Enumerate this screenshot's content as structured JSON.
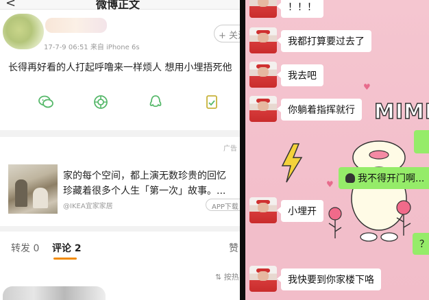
{
  "left": {
    "title": "微博正文",
    "back_glyph": "<",
    "post": {
      "meta": "17-7-9 06:51  来自 iPhone 6s",
      "follow_label": "+ 关注",
      "text": "长得再好看的人打起呼噜来一样烦人 想用小埋捂死他",
      "share_icons": [
        "wechat-icon",
        "moments-icon",
        "qq-icon",
        "save-icon"
      ]
    },
    "ad": {
      "tag": "广告",
      "line1": "家的每个空间，都上演无数珍贵的回忆",
      "line2": "珍藏着很多个人生「第一次」故事。...",
      "brand": "@IKEA宜家家居",
      "download_label": "APP下载"
    },
    "comments": {
      "repost_label": "转发 0",
      "comment_label": "评论 2",
      "like_label": "赞",
      "sort_label": "按热"
    },
    "colors": {
      "accent": "#f28a00",
      "share_green": "#56b86a"
    }
  },
  "right": {
    "messages": [
      {
        "side": "left",
        "text": "！！！"
      },
      {
        "side": "left",
        "text": "我都打算要过去了"
      },
      {
        "side": "left",
        "text": "我去吧"
      },
      {
        "side": "left",
        "text": "你躺着指挥就行"
      },
      {
        "side": "right",
        "text": "我不得开门啊..."
      },
      {
        "side": "left",
        "text": "小埋开"
      },
      {
        "side": "right",
        "text": "？"
      },
      {
        "side": "left",
        "text": "我快要到你家楼下咯"
      }
    ],
    "sticker_text": "MIMI",
    "colors": {
      "background": "#f3c0cc",
      "my_bubble": "#95ec69"
    }
  }
}
